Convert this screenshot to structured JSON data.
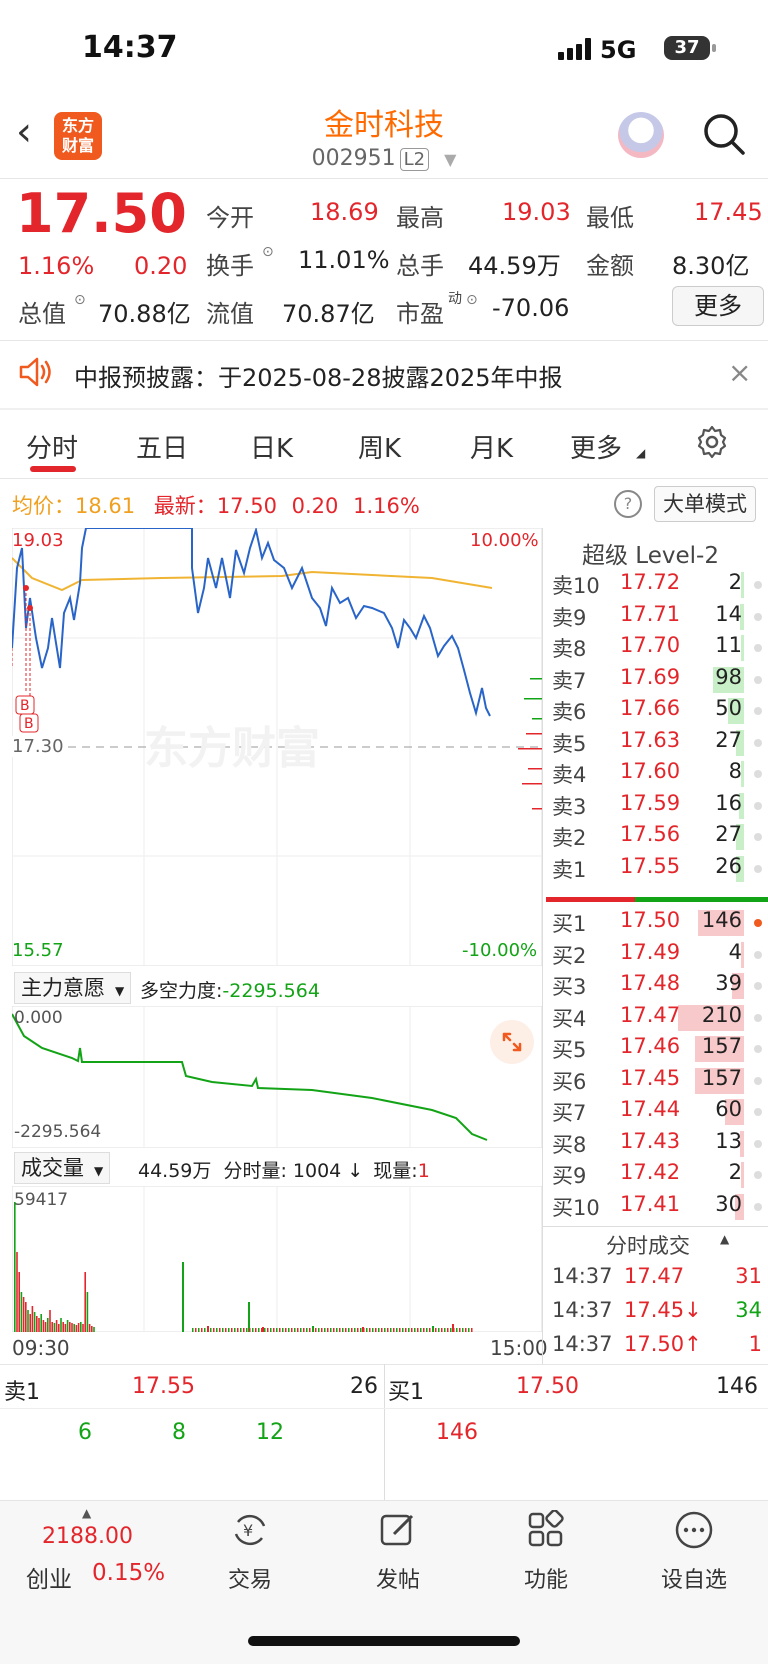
{
  "status_bar": {
    "time": "14:37",
    "network": "5G",
    "battery": "37"
  },
  "header": {
    "name": "金时科技",
    "code": "002951",
    "level": "L2",
    "logo_text": "东方财富"
  },
  "quote": {
    "price": "17.50",
    "change_pct": "1.16%",
    "change": "0.20",
    "open_label": "今开",
    "open": "18.69",
    "high_label": "最高",
    "high": "19.03",
    "low_label": "最低",
    "low": "17.45",
    "turnover_label": "换手",
    "turnover": "11.01%",
    "volume_label": "总手",
    "volume": "44.59万",
    "amount_label": "金额",
    "amount": "8.30亿",
    "total_value_label": "总值",
    "total_value": "70.88亿",
    "float_value_label": "流值",
    "float_value": "70.87亿",
    "pe_label": "市盈",
    "pe_sup": "动",
    "pe": "-70.06",
    "more": "更多"
  },
  "notice": {
    "text": "中报预披露：于2025-08-28披露2025年中报"
  },
  "tabs": [
    "分时",
    "五日",
    "日K",
    "周K",
    "月K",
    "更多"
  ],
  "info": {
    "avg_label": "均价：",
    "avg": "18.61",
    "latest_label": "最新：",
    "latest": "17.50",
    "change": "0.20",
    "change_pct": "1.16%",
    "big_order_mode": "大单模式"
  },
  "chart_data": [
    {
      "type": "line",
      "series": [
        {
          "name": "price"
        },
        {
          "name": "avg"
        }
      ],
      "price_axis": {
        "top": "19.03",
        "mid": "17.30",
        "bottom": "15.57"
      },
      "pct_axis": {
        "top": "10.00%",
        "bottom": "-10.00%"
      },
      "start_time": "09:30",
      "end_time": "15:00",
      "watermark": "东方财富",
      "markers": [
        "B",
        "B"
      ]
    },
    {
      "type": "line",
      "indicator_select": "主力意愿",
      "label": "多空力度:",
      "value": "-2295.564",
      "ymax": "0.000",
      "ymin": "-2295.564"
    },
    {
      "type": "bar",
      "indicator_select": "成交量",
      "total": "44.59万",
      "tick_label": "分时量:",
      "tick_value": "1004",
      "tick_arrow": "↓",
      "current_label": "现量:",
      "current": "1",
      "ymax": "59417"
    }
  ],
  "order_book": {
    "title": "超级 Level-2",
    "asks": [
      {
        "label": "卖10",
        "price": "17.72",
        "vol": "2",
        "vnum": 2
      },
      {
        "label": "卖9",
        "price": "17.71",
        "vol": "14",
        "vnum": 14
      },
      {
        "label": "卖8",
        "price": "17.70",
        "vol": "11",
        "vnum": 11
      },
      {
        "label": "卖7",
        "price": "17.69",
        "vol": "98",
        "vnum": 98
      },
      {
        "label": "卖6",
        "price": "17.66",
        "vol": "50",
        "vnum": 50
      },
      {
        "label": "卖5",
        "price": "17.63",
        "vol": "27",
        "vnum": 27
      },
      {
        "label": "卖4",
        "price": "17.60",
        "vol": "8",
        "vnum": 8
      },
      {
        "label": "卖3",
        "price": "17.59",
        "vol": "16",
        "vnum": 16
      },
      {
        "label": "卖2",
        "price": "17.56",
        "vol": "27",
        "vnum": 27
      },
      {
        "label": "卖1",
        "price": "17.55",
        "vol": "26",
        "vnum": 26
      }
    ],
    "bids": [
      {
        "label": "买1",
        "price": "17.50",
        "vol": "146",
        "vnum": 146
      },
      {
        "label": "买2",
        "price": "17.49",
        "vol": "4",
        "vnum": 4
      },
      {
        "label": "买3",
        "price": "17.48",
        "vol": "39",
        "vnum": 39
      },
      {
        "label": "买4",
        "price": "17.47",
        "vol": "210",
        "vnum": 210
      },
      {
        "label": "买5",
        "price": "17.46",
        "vol": "157",
        "vnum": 157
      },
      {
        "label": "买6",
        "price": "17.45",
        "vol": "157",
        "vnum": 157
      },
      {
        "label": "买7",
        "price": "17.44",
        "vol": "60",
        "vnum": 60
      },
      {
        "label": "买8",
        "price": "17.43",
        "vol": "13",
        "vnum": 13
      },
      {
        "label": "买9",
        "price": "17.42",
        "vol": "2",
        "vnum": 2
      },
      {
        "label": "买10",
        "price": "17.41",
        "vol": "30",
        "vnum": 30
      }
    ]
  },
  "ticks": {
    "title": "分时成交",
    "rows": [
      {
        "time": "14:37",
        "price": "17.47",
        "vol": "31",
        "arrow": ""
      },
      {
        "time": "14:37",
        "price": "17.45↓",
        "vol": "34",
        "arrow": "down"
      },
      {
        "time": "14:37",
        "price": "17.50↑",
        "vol": "1",
        "arrow": "up"
      }
    ]
  },
  "queue": {
    "ask_label": "卖1",
    "ask_price": "17.55",
    "ask_vol": "26",
    "bid_label": "买1",
    "bid_price": "17.50",
    "bid_vol": "146",
    "ask_orders": [
      "6",
      "8",
      "12"
    ],
    "bid_orders": [
      "146"
    ]
  },
  "bottom_nav": {
    "index_value": "2188.00",
    "index_name": "创业",
    "index_pct": "0.15%",
    "items": [
      "交易",
      "发帖",
      "功能",
      "设自选"
    ]
  }
}
